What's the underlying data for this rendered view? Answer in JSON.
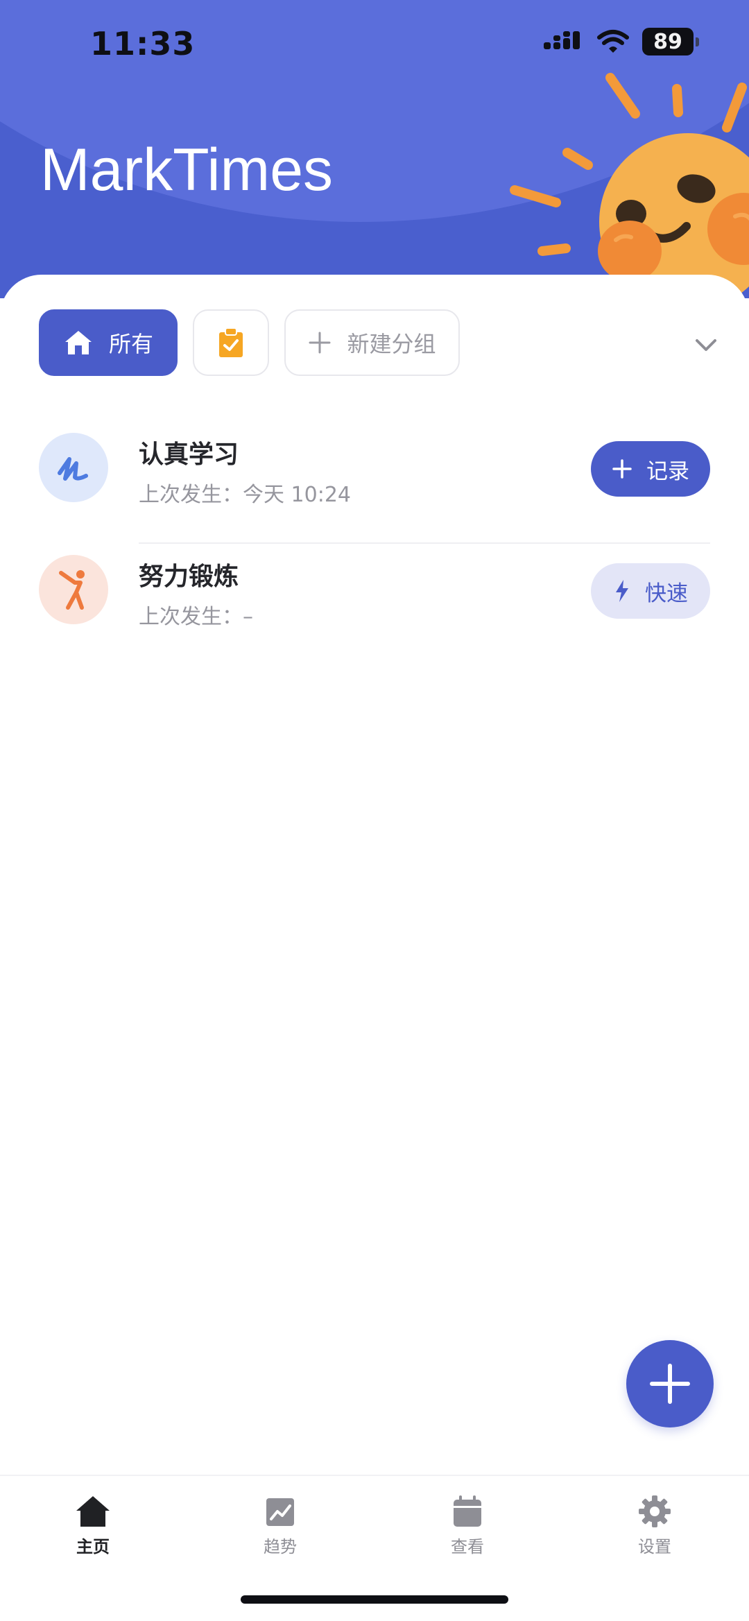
{
  "status_bar": {
    "time": "11:33",
    "battery": "89"
  },
  "header": {
    "title": "MarkTimes"
  },
  "groups": {
    "all_label": "所有",
    "new_group_label": "新建分组"
  },
  "items": [
    {
      "name": "认真学习",
      "meta": "上次发生：今天 10:24",
      "action": "记录",
      "action_icon": "plus-icon",
      "icon": "scribble-icon",
      "icon_bg": "#dfe8fb",
      "icon_color": "#4e7be0"
    },
    {
      "name": "努力锻炼",
      "meta": "上次发生：–",
      "action": "快速",
      "action_icon": "bolt-icon",
      "icon": "stretch-icon",
      "icon_bg": "#fbe4dc",
      "icon_color": "#ee7a3e"
    }
  ],
  "tabbar": {
    "items": [
      {
        "label": "主页",
        "icon": "home-icon",
        "active": true
      },
      {
        "label": "趋势",
        "icon": "trend-icon",
        "active": false
      },
      {
        "label": "查看",
        "icon": "calendar-icon",
        "active": false
      },
      {
        "label": "设置",
        "icon": "gear-icon",
        "active": false
      }
    ]
  },
  "colors": {
    "brand": "#4a5cc9",
    "header": "#4a5fce",
    "accent_orange": "#f6a623"
  }
}
